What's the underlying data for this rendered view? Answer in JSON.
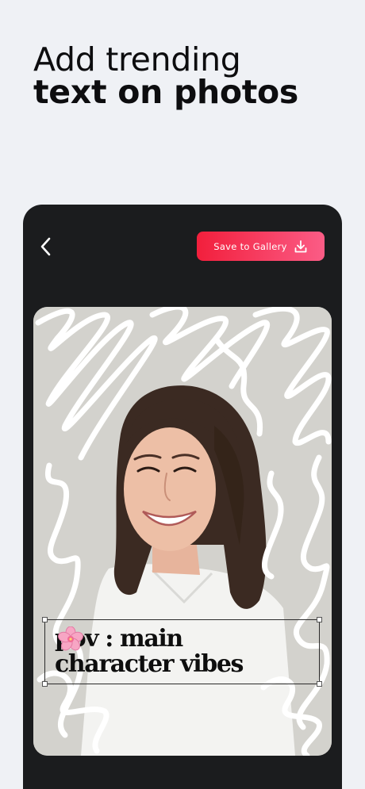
{
  "headline": {
    "line1": "Add trending",
    "line2": "text on photos"
  },
  "toolbar": {
    "back_icon": "chevron-left-icon",
    "save_label": "Save to Gallery",
    "save_icon": "download-icon",
    "save_gradient": [
      "#f21f3c",
      "#fb5c86"
    ]
  },
  "overlay": {
    "line1": "pov : main",
    "line2": "character vibes",
    "emoji_icon": "cherry-blossom-icon"
  },
  "colors": {
    "background": "#eff1f5",
    "editor": "#1b1c1e",
    "scribble": "#ffffff"
  }
}
